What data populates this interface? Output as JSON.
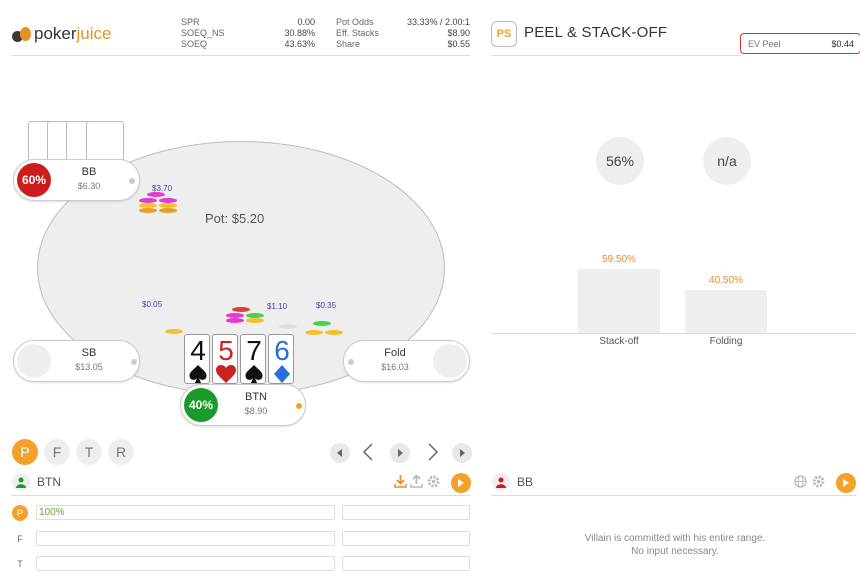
{
  "brand": {
    "name_part1": "poker",
    "name_part2": "juice"
  },
  "stats_left": [
    {
      "label": "SPR",
      "value": "0.00"
    },
    {
      "label": "SOEQ_NS",
      "value": "30.88%"
    },
    {
      "label": "SOEQ",
      "value": "43.63%"
    }
  ],
  "stats_right": [
    {
      "label": "Pot Odds",
      "value": "33.33% / 2.00:1"
    },
    {
      "label": "Eff. Stacks",
      "value": "$8.90"
    },
    {
      "label": "Share",
      "value": "$0.55"
    }
  ],
  "table": {
    "pot": "Pot: $5.20",
    "bets": {
      "bb": "$3.70",
      "sb": "$0.05",
      "btn_left": "$1.10",
      "btn_right": "$0.35"
    },
    "seats": {
      "bb": {
        "name": "BB",
        "stack": "$6.30",
        "equity": "60%"
      },
      "sb": {
        "name": "SB",
        "stack": "$13.05"
      },
      "co": {
        "name": "Fold",
        "stack": "$16.03"
      },
      "btn": {
        "name": "BTN",
        "stack": "$8.90",
        "equity": "40%"
      }
    },
    "board": [
      {
        "rank": "4",
        "suit": "spade",
        "color": "#111111"
      },
      {
        "rank": "5",
        "suit": "heart",
        "color": "#cc2222"
      },
      {
        "rank": "7",
        "suit": "spade",
        "color": "#111111"
      },
      {
        "rank": "6",
        "suit": "diamond",
        "color": "#2a6fd6"
      }
    ]
  },
  "streets": [
    "P",
    "F",
    "T",
    "R"
  ],
  "active_street": "P",
  "hero": {
    "name": "BTN",
    "rows": [
      {
        "label": "P",
        "value": "100%"
      },
      {
        "label": "F",
        "value": ""
      },
      {
        "label": "T",
        "value": ""
      }
    ]
  },
  "panel": {
    "logo": "PS",
    "title": "PEEL & STACK-OFF",
    "ev_label": "EV Peel",
    "ev_value": "$0.44",
    "circle_stats": [
      "56%",
      "n/a"
    ],
    "villain_name": "BB",
    "message_line1": "Villain is committed with his entire range.",
    "message_line2": "No input necessary."
  },
  "chart_data": {
    "type": "bar",
    "categories": [
      "Stack-off",
      "Folding"
    ],
    "values": [
      59.5,
      40.5
    ],
    "value_labels": [
      "59.50%",
      "40.50%"
    ],
    "ylim": [
      0,
      100
    ]
  },
  "colors": {
    "accent": "#f3a12b",
    "equity_high": "#cc1c1c",
    "equity_low": "#1a9a2a",
    "ev_border": "#dd3333"
  }
}
